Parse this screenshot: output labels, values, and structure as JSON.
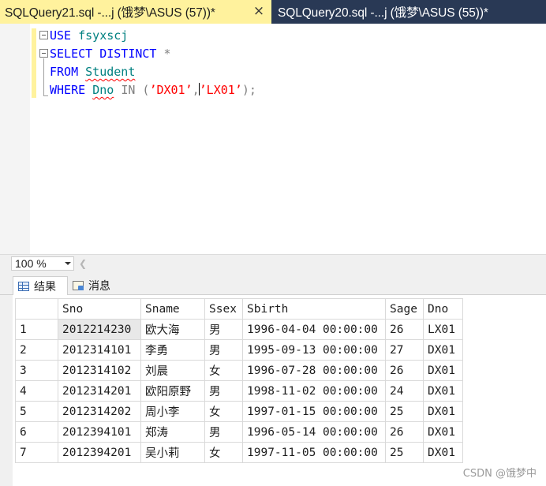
{
  "tabs": [
    {
      "label": "SQLQuery21.sql -...j (饿梦\\ASUS (57))*",
      "active": true,
      "close_glyph": "×"
    },
    {
      "label": "SQLQuery20.sql -...j (饿梦\\ASUS (55))*",
      "active": false
    }
  ],
  "editor": {
    "lines": [
      {
        "parts": [
          {
            "t": "USE",
            "c": "kw"
          },
          {
            "t": " "
          },
          {
            "t": "fsyxscj",
            "c": "ident"
          }
        ]
      },
      {
        "parts": [
          {
            "t": "SELECT",
            "c": "kw"
          },
          {
            "t": " "
          },
          {
            "t": "DISTINCT",
            "c": "kw"
          },
          {
            "t": " "
          },
          {
            "t": "*",
            "c": "gray"
          }
        ]
      },
      {
        "parts": [
          {
            "t": "FROM",
            "c": "kw"
          },
          {
            "t": " "
          },
          {
            "t": "Student",
            "c": "ident squiggle"
          }
        ]
      },
      {
        "parts": [
          {
            "t": "WHERE",
            "c": "kw"
          },
          {
            "t": " "
          },
          {
            "t": "Dno",
            "c": "ident squiggle"
          },
          {
            "t": " "
          },
          {
            "t": "IN",
            "c": "gray"
          },
          {
            "t": " "
          },
          {
            "t": "(",
            "c": "gray"
          },
          {
            "t": "’DX01’",
            "c": "str"
          },
          {
            "t": ",",
            "c": "gray"
          },
          {
            "t": "",
            "c": "caret"
          },
          {
            "t": "’LX01’",
            "c": "str"
          },
          {
            "t": ");",
            "c": "gray"
          }
        ]
      }
    ]
  },
  "zoom": {
    "value": "100 %"
  },
  "result_tabs": [
    {
      "label": "结果",
      "icon": "grid-icon"
    },
    {
      "label": "消息",
      "icon": "messages-icon"
    }
  ],
  "grid": {
    "columns": [
      "",
      "Sno",
      "Sname",
      "Ssex",
      "Sbirth",
      "Sage",
      "Dno"
    ],
    "rows": [
      [
        "1",
        "2012214230",
        "欧大海",
        "男",
        "1996-04-04 00:00:00",
        "26",
        "LX01"
      ],
      [
        "2",
        "2012314101",
        "李勇",
        "男",
        "1995-09-13 00:00:00",
        "27",
        "DX01"
      ],
      [
        "3",
        "2012314102",
        "刘晨",
        "女",
        "1996-07-28 00:00:00",
        "26",
        "DX01"
      ],
      [
        "4",
        "2012314201",
        "欧阳原野",
        "男",
        "1998-11-02 00:00:00",
        "24",
        "DX01"
      ],
      [
        "5",
        "2012314202",
        "周小李",
        "女",
        "1997-01-15 00:00:00",
        "25",
        "DX01"
      ],
      [
        "6",
        "2012394101",
        "郑涛",
        "男",
        "1996-05-14 00:00:00",
        "26",
        "DX01"
      ],
      [
        "7",
        "2012394201",
        "吴小莉",
        "女",
        "1997-11-05 00:00:00",
        "25",
        "DX01"
      ]
    ]
  },
  "watermark": "CSDN @饿梦中"
}
